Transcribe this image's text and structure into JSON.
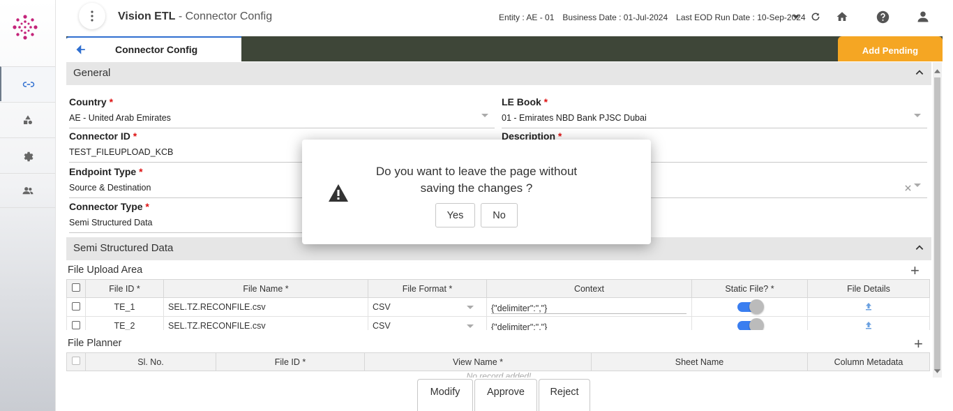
{
  "header": {
    "app_name": "Vision ETL",
    "page_name": " - Connector Config",
    "entity_label": "Entity : ",
    "entity_value": "AE - 01",
    "business_date_label": "Business Date : ",
    "business_date_value": "01-Jul-2024",
    "eod_label": "Last EOD Run Date : ",
    "eod_value": "10-Sep-2024"
  },
  "tab": {
    "label": "Connector Config",
    "add_pending": "Add Pending"
  },
  "general": {
    "title": "General",
    "country": {
      "label": "Country",
      "value": "AE - United Arab Emirates"
    },
    "le_book": {
      "label": "LE Book",
      "value": "01 - Emirates NBD Bank PJSC Dubai"
    },
    "connector_id": {
      "label": "Connector ID",
      "value": "TEST_FILEUPLOAD_KCB"
    },
    "description": {
      "label": "Description"
    },
    "endpoint_type": {
      "label": "Endpoint Type",
      "value": "Source & Destination"
    },
    "connector_type": {
      "label": "Connector Type",
      "value": "Semi Structured Data"
    },
    "required_mark": "*"
  },
  "semi": {
    "title": "Semi Structured Data",
    "upload_area": "File Upload Area",
    "columns": [
      "File ID *",
      "File Name *",
      "File Format *",
      "Context",
      "Static File? *",
      "File Details"
    ],
    "rows": [
      {
        "file_id": "TE_1",
        "file_name": "SEL.TZ.RECONFILE.csv",
        "format": "CSV",
        "context": "{\"delimiter\":\",\"}",
        "static": true
      },
      {
        "file_id": "TE_2",
        "file_name": "SEL.TZ.RECONFILE.csv",
        "format": "CSV",
        "context": "{\"delimiter\":\",\"}",
        "static": true
      }
    ],
    "planner": "File Planner",
    "planner_columns": [
      "Sl. No.",
      "File ID *",
      "View Name *",
      "Sheet Name",
      "Column Metadata"
    ],
    "no_record": "No record added!"
  },
  "actions": {
    "modify": "Modify",
    "approve": "Approve",
    "reject": "Reject"
  },
  "dialog": {
    "line1": "Do you want to leave the page without",
    "line2": "saving the changes ?",
    "yes": "Yes",
    "no": "No"
  }
}
